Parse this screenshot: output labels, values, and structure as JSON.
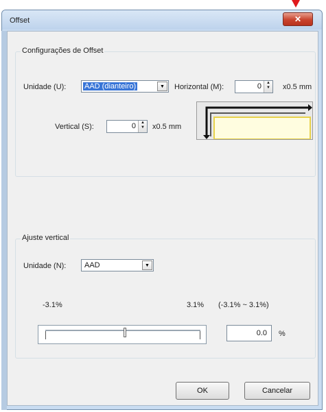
{
  "window": {
    "title": "Offset",
    "close_symbol": "✕"
  },
  "offset_group": {
    "legend": "Configurações de Offset",
    "unit_label": "Unidade (U):",
    "unit_value": "AAD (dianteiro)",
    "horizontal_label": "Horizontal (M):",
    "horizontal_value": "0",
    "horizontal_unit": "x0.5 mm",
    "vertical_label": "Vertical (S):",
    "vertical_value": "0",
    "vertical_unit": "x0.5 mm"
  },
  "adjust_group": {
    "legend": "Ajuste vertical",
    "unit_label": "Unidade (N):",
    "unit_value": "AAD",
    "min_label": "-3.1%",
    "max_label": "3.1%",
    "range_label": "(-3.1% ~ 3.1%)",
    "value": "0.0",
    "value_unit": "%"
  },
  "buttons": {
    "ok": "OK",
    "cancel": "Cancelar"
  },
  "colors": {
    "selection": "#3875d7",
    "preview_fill": "#fffde0",
    "preview_border": "#e8d24a",
    "close": "#c9442e"
  }
}
